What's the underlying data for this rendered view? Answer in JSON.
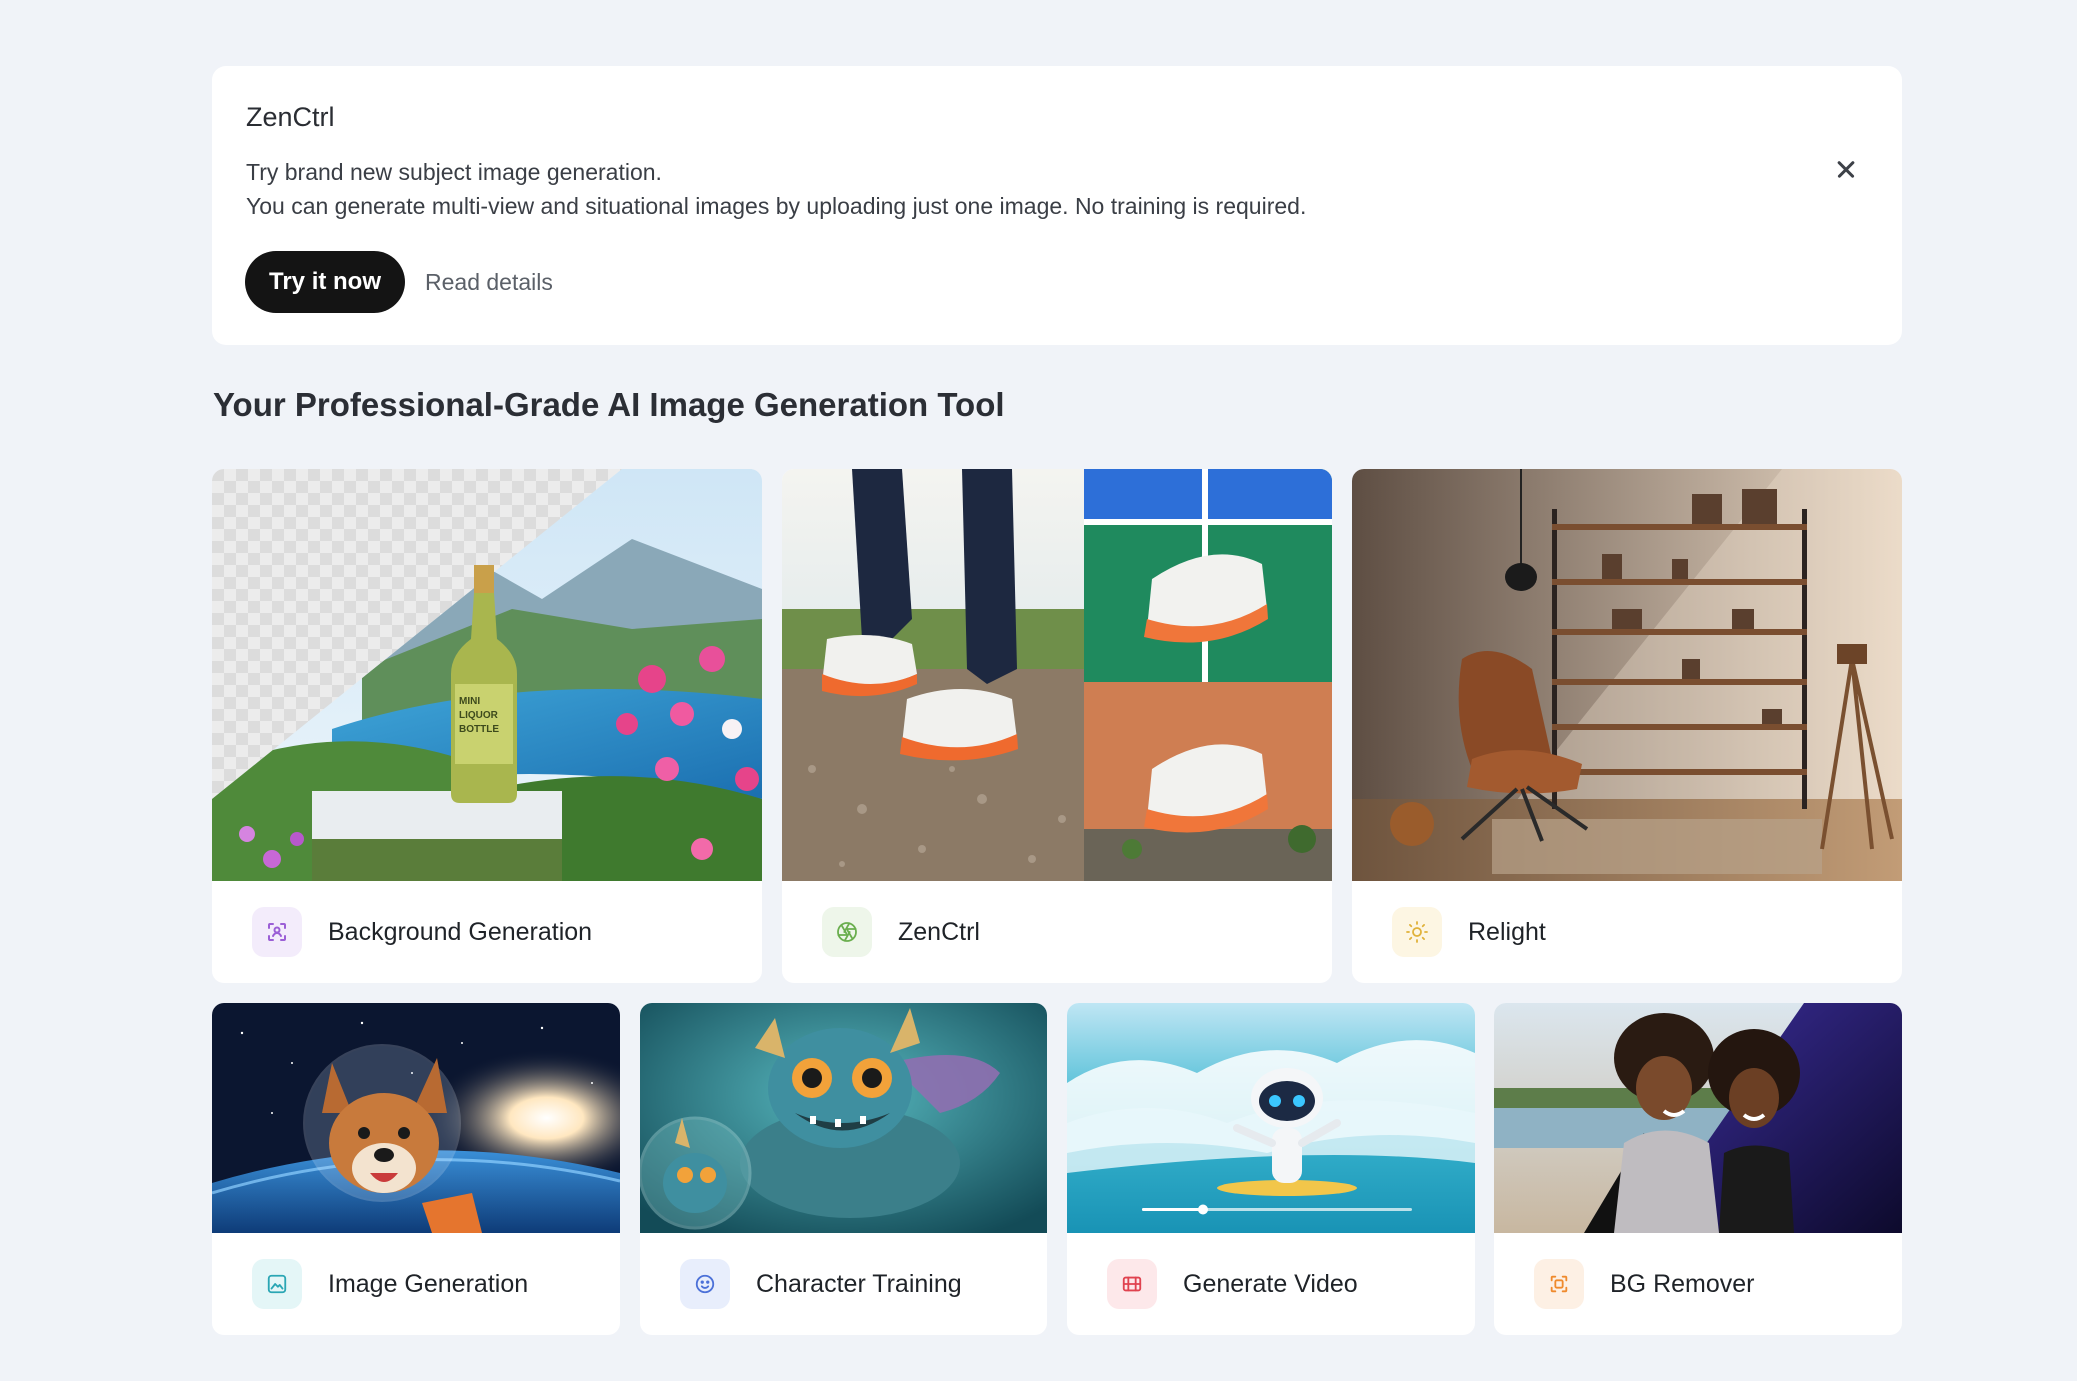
{
  "banner": {
    "title": "ZenCtrl",
    "line1": "Try brand new subject image generation.",
    "line2": "You can generate multi-view and situational images by uploading just one image. No training is required.",
    "primary_label": "Try it now",
    "secondary_label": "Read details"
  },
  "section_title": "Your Professional-Grade AI Image Generation Tool",
  "tools": [
    {
      "label": "Background Generation",
      "icon": "scan-user-icon",
      "icon_bg": "#f3ecfb",
      "icon_color": "#9b5fd6"
    },
    {
      "label": "ZenCtrl",
      "icon": "aperture-icon",
      "icon_bg": "#eef6ea",
      "icon_color": "#6aae4e"
    },
    {
      "label": "Relight",
      "icon": "sun-icon",
      "icon_bg": "#fdf6e3",
      "icon_color": "#e0b23a"
    },
    {
      "label": "Image Generation",
      "icon": "image-icon",
      "icon_bg": "#e4f6f7",
      "icon_color": "#2aa6b4"
    },
    {
      "label": "Character Training",
      "icon": "smile-icon",
      "icon_bg": "#e8eefc",
      "icon_color": "#4c71d8"
    },
    {
      "label": "Generate Video",
      "icon": "film-icon",
      "icon_bg": "#fde8ea",
      "icon_color": "#e0424f"
    },
    {
      "label": "BG Remover",
      "icon": "focus-icon",
      "icon_bg": "#fdf0e4",
      "icon_color": "#ef8a2c"
    }
  ],
  "mini_bottle_label": "MINI\nLIQUOR\nBOTTLE"
}
